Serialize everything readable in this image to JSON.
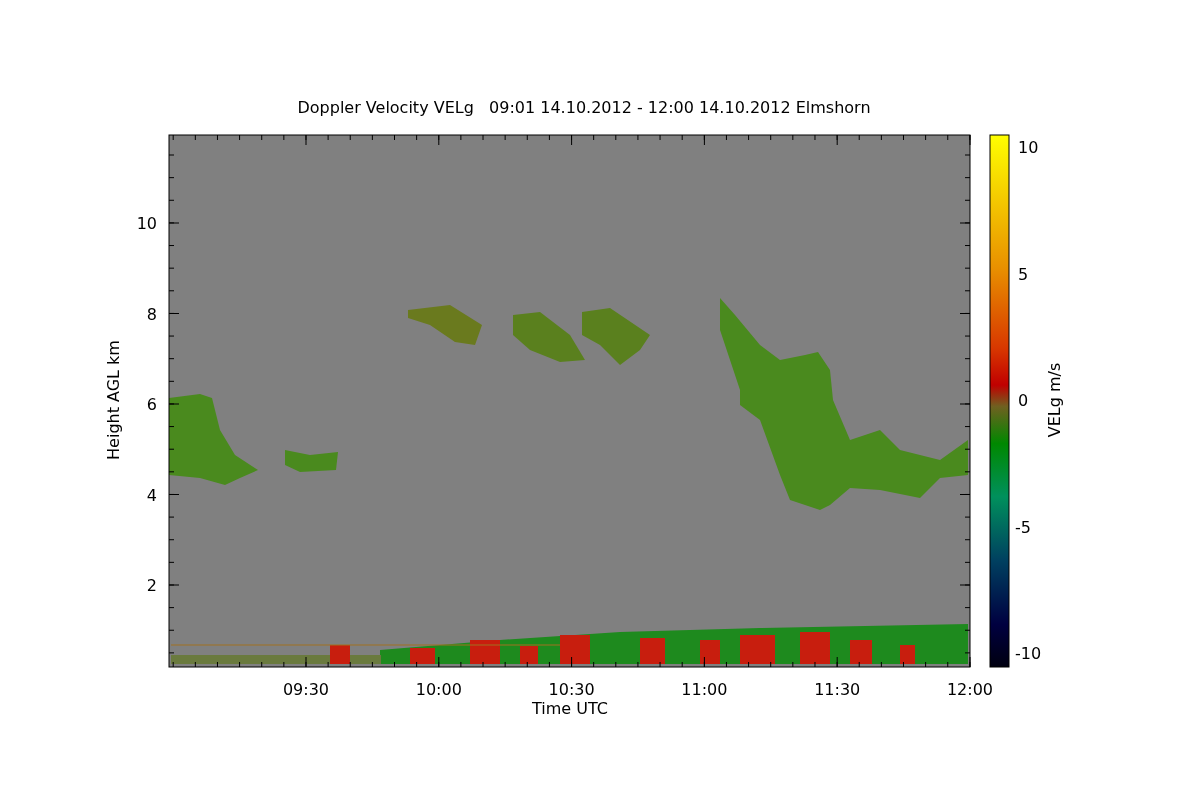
{
  "title": "Doppler Velocity VELg   09:01 14.10.2012 - 12:00 14.10.2012 Elmshorn",
  "y_axis": {
    "label": "Height AGL km",
    "ticks": [
      "10",
      "8",
      "6",
      "4",
      "2"
    ]
  },
  "x_axis": {
    "label": "Time UTC",
    "ticks": [
      "09:30",
      "10:00",
      "10:30",
      "11:00",
      "11:30",
      "12:00"
    ]
  },
  "colorbar": {
    "label": "VELg m/s",
    "ticks": [
      "10",
      "5",
      "0",
      "-5",
      "-10"
    ]
  }
}
